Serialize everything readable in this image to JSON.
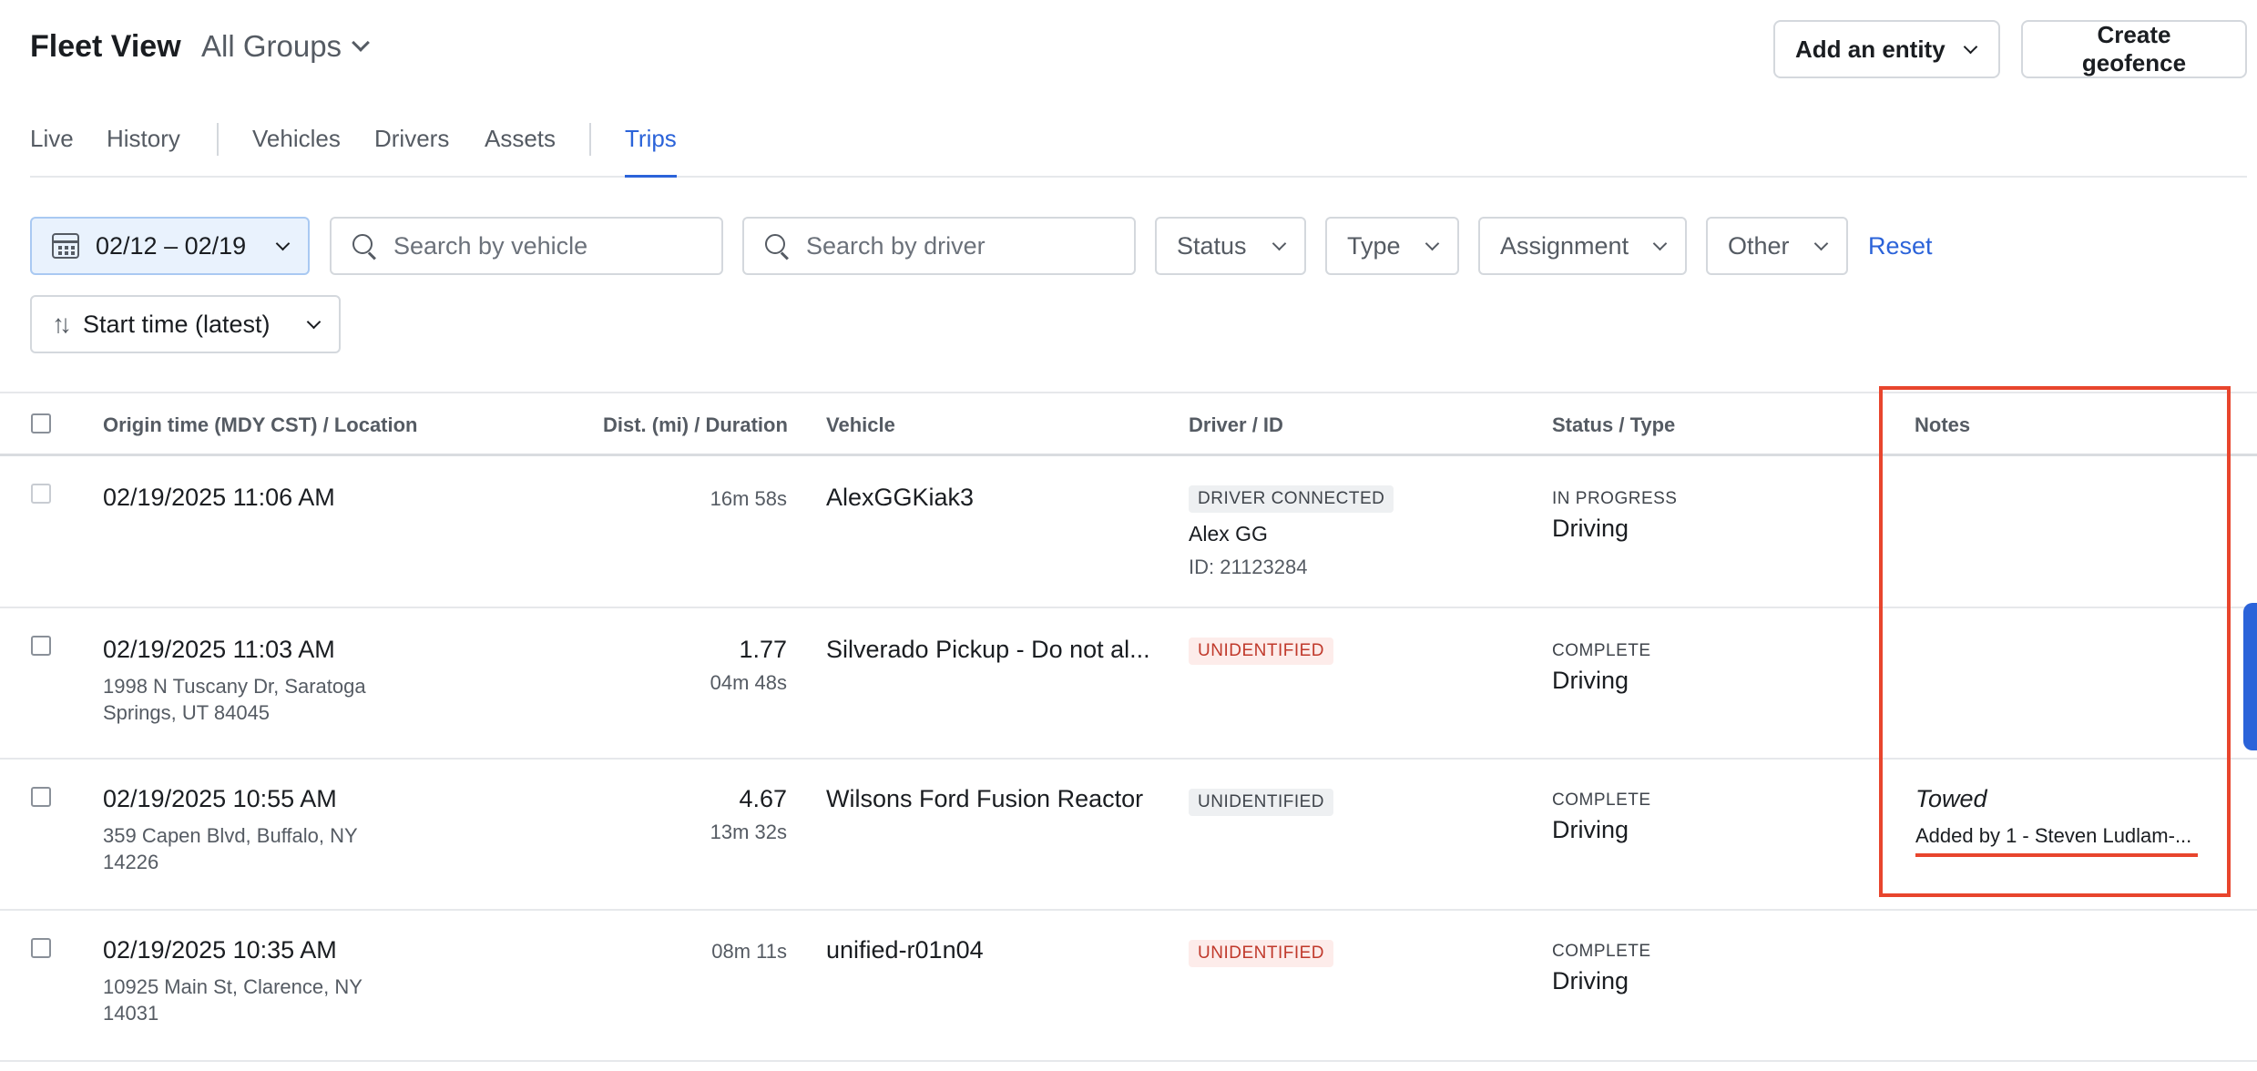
{
  "header": {
    "title": "Fleet View",
    "group_select": "All Groups",
    "add_entity_label": "Add an entity",
    "create_geofence_label": "Create geofence"
  },
  "tabs": [
    {
      "label": "Live"
    },
    {
      "label": "History"
    },
    {
      "label": "Vehicles"
    },
    {
      "label": "Drivers"
    },
    {
      "label": "Assets"
    },
    {
      "label": "Trips",
      "active": true
    }
  ],
  "filters": {
    "date_range": "02/12 – 02/19",
    "vehicle_search_placeholder": "Search by vehicle",
    "driver_search_placeholder": "Search by driver",
    "status": "Status",
    "type": "Type",
    "assignment": "Assignment",
    "other": "Other",
    "reset": "Reset",
    "sort": "Start time (latest)"
  },
  "table": {
    "columns": {
      "origin": "Origin time (MDY CST) / Location",
      "dist": "Dist. (mi) / Duration",
      "vehicle": "Vehicle",
      "driver": "Driver / ID",
      "status": "Status / Type",
      "notes": "Notes"
    },
    "rows": [
      {
        "origin_time": "02/19/2025 11:06 AM",
        "location": "",
        "distance": "",
        "duration": "16m 58s",
        "vehicle": "AlexGGKiak3",
        "driver_badge": "DRIVER CONNECTED",
        "driver_name": "Alex GG",
        "driver_id": "ID: 21123284",
        "status": "IN PROGRESS",
        "type": "Driving",
        "note": "",
        "note_by": ""
      },
      {
        "origin_time": "02/19/2025 11:03 AM",
        "location": "1998 N Tuscany Dr, Saratoga Springs, UT 84045",
        "distance": "1.77",
        "duration": "04m 48s",
        "vehicle": "Silverado Pickup - Do not al...",
        "driver_badge": "UNIDENTIFIED",
        "driver_name": "",
        "driver_id": "",
        "status": "COMPLETE",
        "type": "Driving",
        "note": "",
        "note_by": ""
      },
      {
        "origin_time": "02/19/2025 10:55 AM",
        "location": "359 Capen Blvd, Buffalo, NY 14226",
        "distance": "4.67",
        "duration": "13m 32s",
        "vehicle": "Wilsons Ford Fusion Reactor",
        "driver_badge": "UNIDENTIFIED",
        "driver_name": "",
        "driver_id": "",
        "status": "COMPLETE",
        "type": "Driving",
        "note": "Towed",
        "note_by": "Added by 1 - Steven Ludlam-..."
      },
      {
        "origin_time": "02/19/2025 10:35 AM",
        "location": "10925 Main St, Clarence, NY 14031",
        "distance": "",
        "duration": "08m 11s",
        "vehicle": "unified-r01n04",
        "driver_badge": "UNIDENTIFIED",
        "driver_name": "",
        "driver_id": "",
        "status": "COMPLETE",
        "type": "Driving",
        "note": "",
        "note_by": ""
      }
    ]
  },
  "colors": {
    "accent": "#2b63d9",
    "annotation": "#e8452d"
  }
}
